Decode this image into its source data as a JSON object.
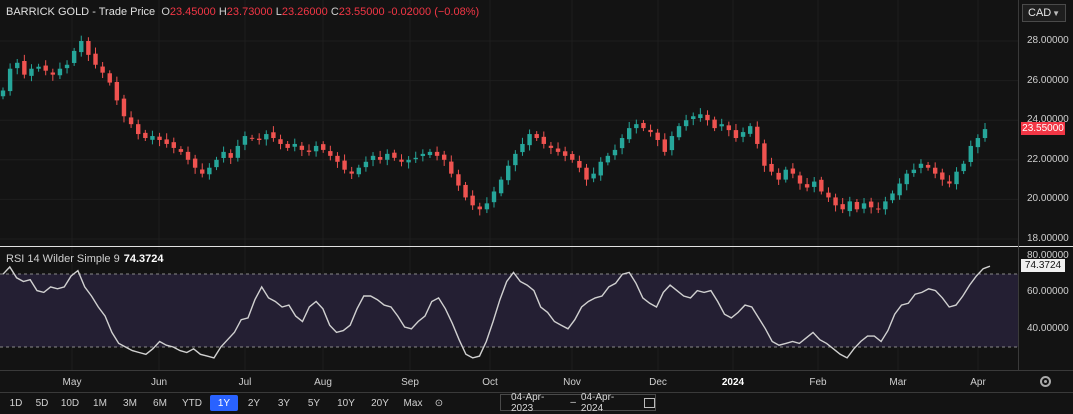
{
  "header": {
    "symbol": "BARRICK GOLD",
    "sep": "-",
    "mode": "Trade Price",
    "o_label": "O",
    "o": "23.45000",
    "h_label": "H",
    "h": "23.73000",
    "l_label": "L",
    "l": "23.26000",
    "c_label": "C",
    "c": "23.55000",
    "change": "-0.02000 (−0.08%)"
  },
  "currency": "CAD",
  "rsi": {
    "label": "RSI 14 Wilder Simple 9",
    "value": "74.3724"
  },
  "price_tag": "23.55000",
  "toolbar": {
    "ranges": [
      "1D",
      "5D",
      "10D",
      "1M",
      "3M",
      "6M",
      "YTD",
      "1Y",
      "2Y",
      "3Y",
      "5Y",
      "10Y",
      "20Y",
      "Max"
    ],
    "active": "1Y",
    "date_from": "04-Apr-2023",
    "date_sep": "–",
    "date_to": "04-Apr-2024"
  },
  "colors": {
    "up": "#26a69a",
    "down": "#ef5350",
    "rsi_line": "#d0d0d0",
    "rsi_band": "#241f33",
    "accent": "#2962ff",
    "price_tag": "#f23645"
  },
  "icons": {
    "reset": "reset-icon",
    "calendar": "calendar-icon",
    "settings": "gear-icon"
  },
  "chart_data": [
    {
      "type": "candlestick",
      "title": "BARRICK GOLD - Trade Price",
      "y_ticks": [
        "28.00000",
        "26.00000",
        "24.00000",
        "22.00000",
        "20.00000",
        "18.00000"
      ],
      "ylim": [
        17.8,
        28.6
      ],
      "x_ticks": [
        "May",
        "Jun",
        "Jul",
        "Aug",
        "Sep",
        "Oct",
        "Nov",
        "Dec",
        "2024",
        "Feb",
        "Mar",
        "Apr"
      ],
      "x_ticks_bold": [
        "2024"
      ],
      "last_close": 23.55,
      "close_series": [
        25.5,
        26.6,
        26.9,
        26.3,
        26.6,
        26.7,
        26.5,
        26.3,
        26.6,
        26.8,
        27.5,
        28.0,
        27.3,
        26.8,
        26.4,
        25.9,
        25.0,
        24.2,
        23.8,
        23.3,
        23.1,
        23.2,
        23.0,
        22.8,
        22.6,
        22.4,
        22.0,
        21.6,
        21.3,
        21.6,
        22.0,
        22.4,
        22.1,
        22.7,
        23.2,
        23.1,
        23.0,
        23.3,
        23.1,
        22.8,
        22.6,
        22.8,
        22.5,
        22.4,
        22.7,
        22.5,
        22.2,
        21.9,
        21.5,
        21.3,
        21.6,
        21.9,
        22.2,
        22.0,
        22.3,
        22.1,
        21.9,
        22.0,
        22.1,
        22.3,
        22.4,
        22.2,
        22.0,
        21.3,
        20.7,
        20.1,
        19.7,
        19.5,
        19.8,
        20.4,
        21.0,
        21.7,
        22.3,
        22.8,
        23.3,
        23.1,
        22.8,
        22.6,
        22.4,
        22.2,
        22.0,
        21.6,
        21.0,
        21.3,
        21.9,
        22.2,
        22.5,
        23.1,
        23.6,
        23.8,
        23.6,
        23.4,
        23.0,
        22.4,
        23.2,
        23.7,
        24.0,
        24.2,
        24.3,
        24.0,
        23.6,
        23.8,
        23.5,
        23.1,
        23.4,
        23.7,
        22.8,
        21.7,
        21.4,
        21.0,
        21.5,
        21.3,
        20.8,
        20.6,
        20.9,
        20.4,
        20.1,
        19.7,
        19.5,
        19.9,
        19.5,
        19.8,
        19.6,
        19.5,
        19.9,
        20.3,
        20.8,
        21.3,
        21.5,
        21.8,
        21.6,
        21.3,
        21.0,
        20.8,
        21.4,
        21.8,
        22.7,
        23.1,
        23.55
      ],
      "note_values_in": "CAD"
    },
    {
      "type": "line",
      "title": "RSI 14 Wilder Simple 9",
      "y_ticks": [
        "80.00000",
        "60.00000",
        "40.00000"
      ],
      "ylim": [
        20,
        80
      ],
      "overbought": 70,
      "oversold": 30,
      "last": 74.3724,
      "rsi_series": [
        70,
        74,
        68,
        66,
        67,
        61,
        60,
        63,
        62,
        63,
        69,
        72,
        63,
        58,
        52,
        47,
        38,
        32,
        30,
        28,
        27,
        26,
        29,
        33,
        31,
        30,
        28,
        27,
        29,
        26,
        25,
        24,
        30,
        34,
        38,
        45,
        46,
        56,
        63,
        57,
        55,
        52,
        53,
        47,
        44,
        52,
        55,
        51,
        42,
        38,
        39,
        42,
        51,
        58,
        58,
        56,
        53,
        52,
        47,
        41,
        40,
        44,
        47,
        55,
        57,
        51,
        43,
        34,
        26,
        24,
        25,
        33,
        44,
        56,
        66,
        71,
        66,
        64,
        61,
        52,
        49,
        44,
        42,
        40,
        45,
        52,
        55,
        57,
        58,
        63,
        65,
        70,
        71,
        65,
        57,
        54,
        52,
        60,
        64,
        61,
        58,
        57,
        61,
        60,
        61,
        55,
        48,
        46,
        49,
        53,
        52,
        46,
        40,
        33,
        31,
        32,
        33,
        32,
        35,
        38,
        34,
        32,
        29,
        26,
        24,
        29,
        33,
        36,
        36,
        33,
        39,
        48,
        53,
        54,
        59,
        60,
        62,
        61,
        57,
        52,
        53,
        58,
        64,
        69,
        73,
        74.37
      ]
    }
  ]
}
